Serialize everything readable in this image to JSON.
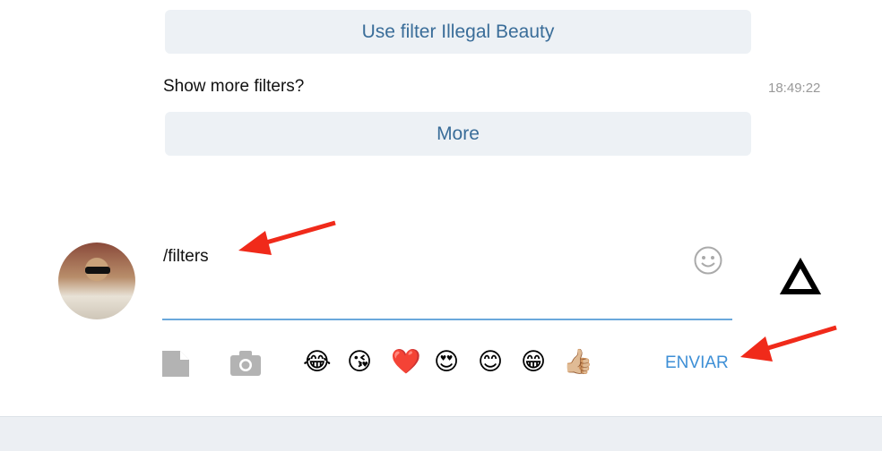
{
  "messages": {
    "filter_button": "Use filter Illegal Beauty",
    "text": "Show more filters?",
    "time": "18:49:22",
    "more_button": "More"
  },
  "composer": {
    "input_value": "/filters",
    "send_label": "ENVIAR",
    "emojis": [
      "😂",
      "😘",
      "❤️",
      "😍",
      "😊",
      "😁",
      "👍🏼"
    ]
  },
  "logo_text": "Δ",
  "colors": {
    "accent": "#3d8fd6",
    "button_bg": "#edf1f5",
    "arrow": "#f02a1a"
  }
}
